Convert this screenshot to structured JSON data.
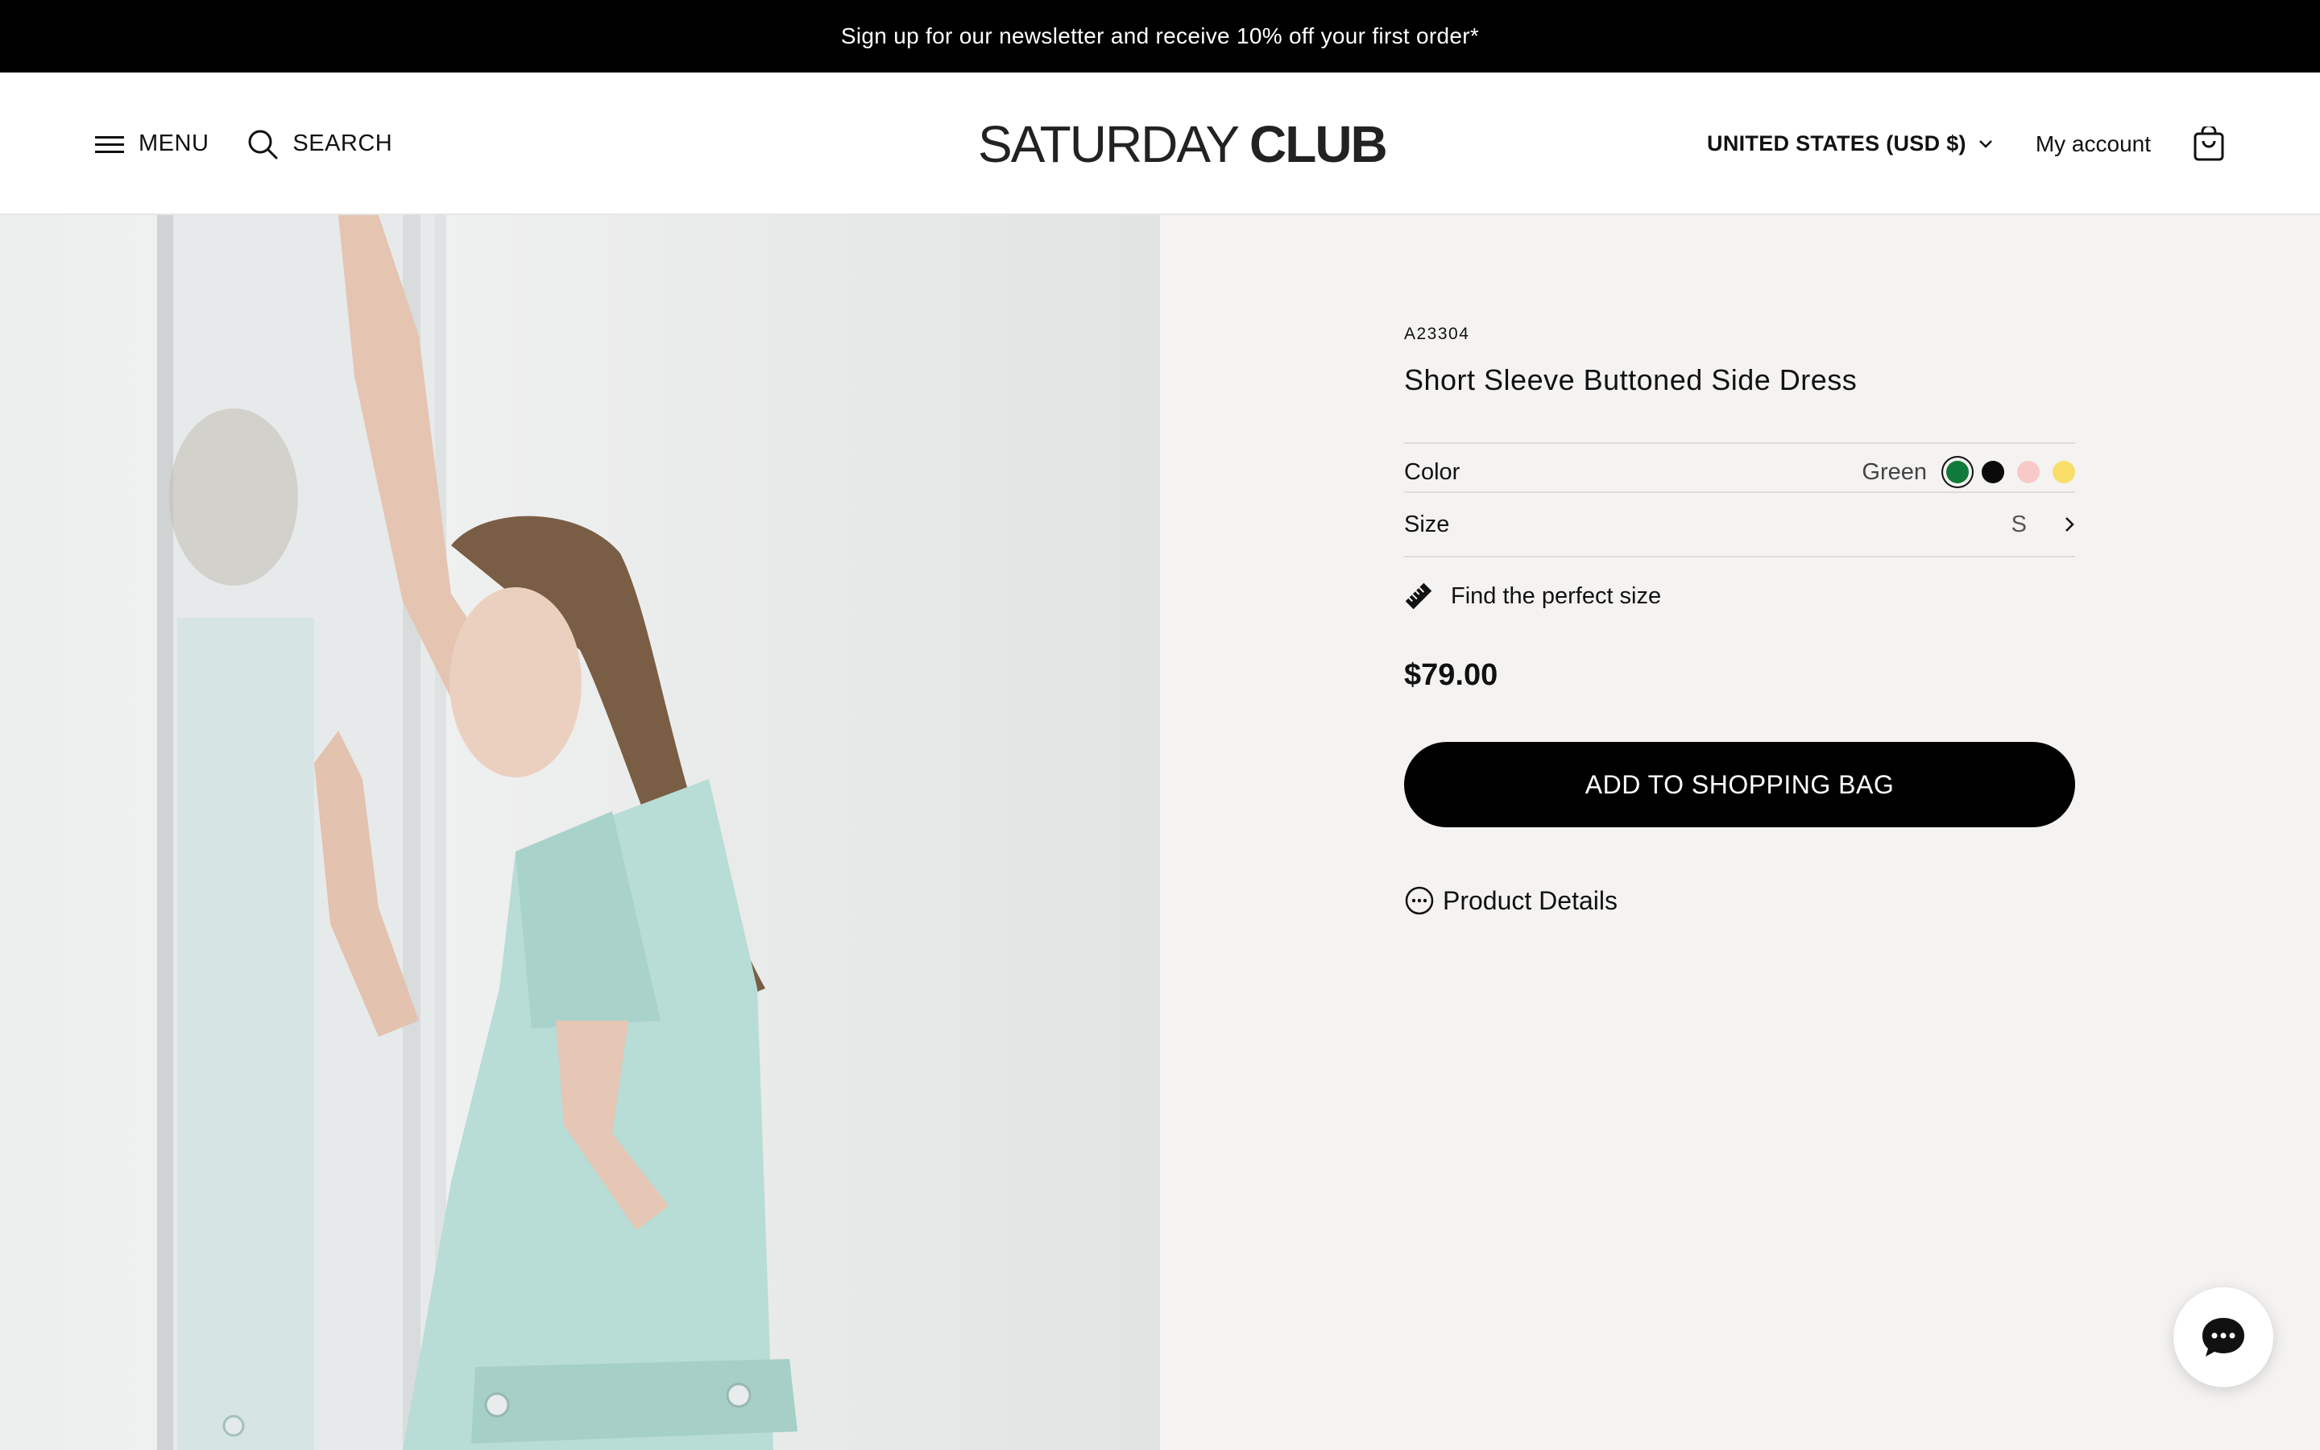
{
  "announcement": {
    "text": "Sign up for our newsletter and receive 10% off your first order*"
  },
  "header": {
    "menu_label": "MENU",
    "search_label": "SEARCH",
    "logo_thin": "SATURDAY",
    "logo_bold": "CLUB",
    "currency": "UNITED STATES (USD $)",
    "account": "My account"
  },
  "product": {
    "sku": "A23304",
    "title": "Short Sleeve Buttoned Side Dress",
    "color_label": "Color",
    "color_selected": "Green",
    "swatches": [
      {
        "name": "green",
        "color": "#0f7a3a",
        "selected": true
      },
      {
        "name": "black",
        "color": "#0a0a0a",
        "selected": false
      },
      {
        "name": "pink",
        "color": "#f7c9c8",
        "selected": false
      },
      {
        "name": "yellow",
        "color": "#f9de6a",
        "selected": false
      }
    ],
    "size_label": "Size",
    "size_value": "S",
    "fit_label": "Find the perfect size",
    "price": "$79.00",
    "cta_label": "ADD TO SHOPPING BAG",
    "details_label": "Product Details"
  },
  "colors": {
    "accent": "#000000",
    "panel_bg": "#f4f3f1",
    "dress": "#b8dcd6"
  }
}
